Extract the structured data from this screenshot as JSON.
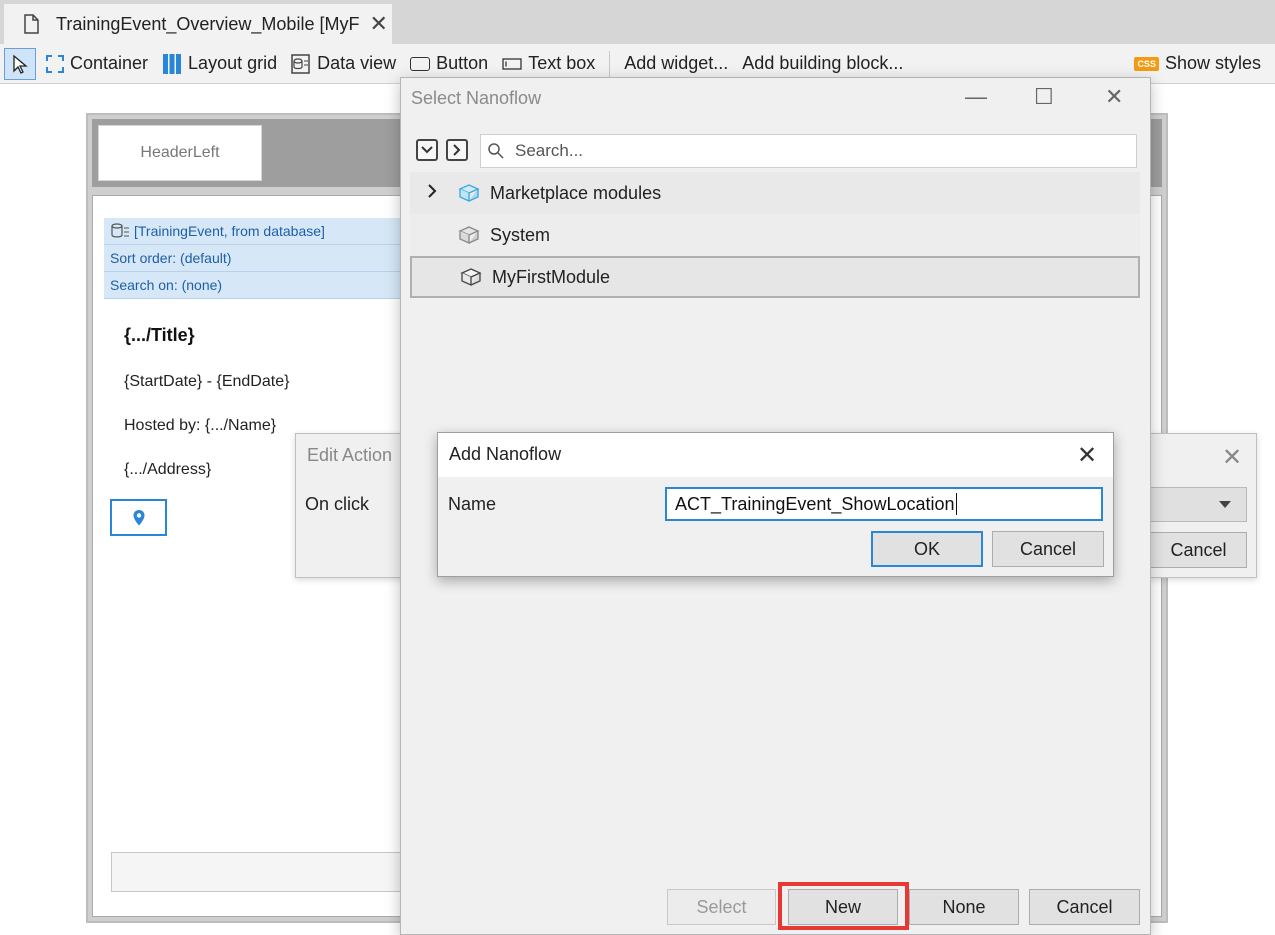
{
  "tab": {
    "title": "TrainingEvent_Overview_Mobile [MyF",
    "close": "✕"
  },
  "toolbar": {
    "items": [
      "Container",
      "Layout grid",
      "Data view",
      "Button",
      "Text box"
    ],
    "add_widget": "Add widget...",
    "add_building_block": "Add building block...",
    "css_badge": "CSS",
    "show_styles": "Show styles",
    "colors": {
      "accent": "#2a86d6",
      "css_badge": "#f39c12"
    }
  },
  "page": {
    "header_left": "HeaderLeft",
    "dataview": {
      "source": "[TrainingEvent, from database]",
      "sort": "Sort order: (default)",
      "search": "Search on: (none)"
    },
    "title": "{.../Title}",
    "dates": "{StartDate} - {EndDate}",
    "hosted": "Hosted by: {.../Name}",
    "address": "{.../Address}"
  },
  "edit_action": {
    "title": "Edit Action",
    "on_click": "On click",
    "cancel": "Cancel",
    "close": "✕"
  },
  "select_nanoflow": {
    "title": "Select Nanoflow",
    "minimize": "—",
    "maximize": "☐",
    "close": "✕",
    "search_placeholder": "Search...",
    "tree": [
      {
        "label": "Marketplace modules",
        "expandable": true
      },
      {
        "label": "System",
        "expandable": false
      },
      {
        "label": "MyFirstModule",
        "expandable": false,
        "selected": true
      }
    ],
    "buttons": {
      "select": "Select",
      "new": "New",
      "none": "None",
      "cancel": "Cancel"
    }
  },
  "add_nanoflow": {
    "title": "Add Nanoflow",
    "name_label": "Name",
    "name_value": "ACT_TrainingEvent_ShowLocation",
    "ok": "OK",
    "cancel": "Cancel",
    "close": "✕"
  }
}
